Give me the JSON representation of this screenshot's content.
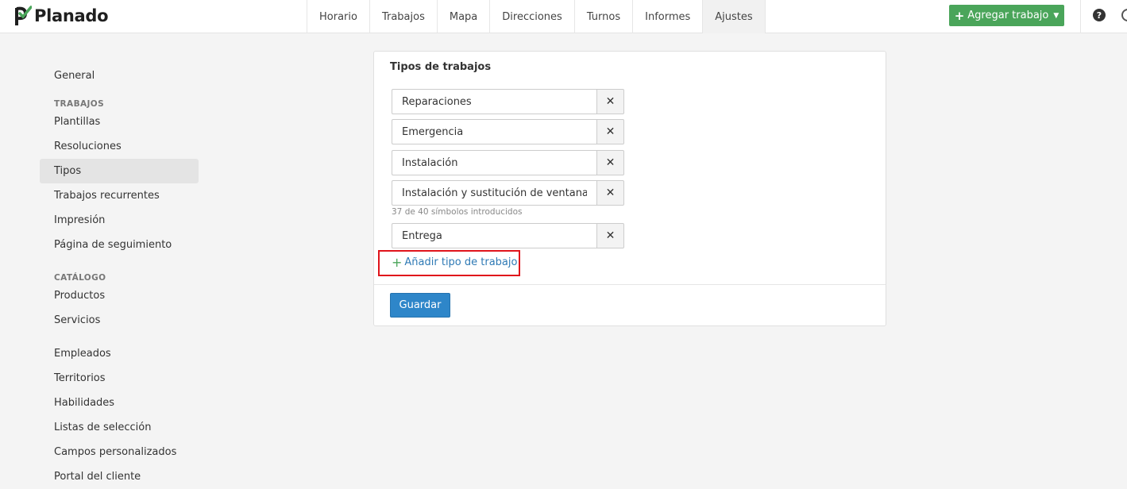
{
  "app": {
    "name": "Planado"
  },
  "nav": {
    "items": [
      {
        "label": "Horario"
      },
      {
        "label": "Trabajos"
      },
      {
        "label": "Mapa"
      },
      {
        "label": "Direcciones"
      },
      {
        "label": "Turnos"
      },
      {
        "label": "Informes"
      },
      {
        "label": "Ajustes",
        "active": true
      }
    ]
  },
  "header": {
    "add_job_label": "Agregar trabajo",
    "help_label": "?"
  },
  "sidebar": {
    "general": "General",
    "sections": {
      "trabajos_header": "TRABAJOS",
      "trabajos_items": [
        "Plantillas",
        "Resoluciones",
        "Tipos",
        "Trabajos recurrentes",
        "Impresión",
        "Página de seguimiento"
      ],
      "catalogo_header": "CATÁLOGO",
      "catalogo_items": [
        "Productos",
        "Servicios"
      ],
      "other_items": [
        "Empleados",
        "Territorios",
        "Habilidades",
        "Listas de selección",
        "Campos personalizados",
        "Portal del cliente"
      ]
    },
    "active_item": "Tipos"
  },
  "main": {
    "title": "Tipos de trabajos",
    "types": [
      {
        "value": "Reparaciones"
      },
      {
        "value": "Emergencia"
      },
      {
        "value": "Instalación"
      },
      {
        "value": "Instalación y sustitución de ventanas"
      },
      {
        "value": "Entrega"
      }
    ],
    "char_counter": "37 de 40 símbolos introducidos",
    "add_type_label": "Añadir tipo de trabajo",
    "save_label": "Guardar"
  },
  "colors": {
    "brand_green": "#4aa55a",
    "primary_blue": "#2e86c9",
    "link_blue": "#2f7ab5",
    "highlight_red": "#e0141b"
  }
}
